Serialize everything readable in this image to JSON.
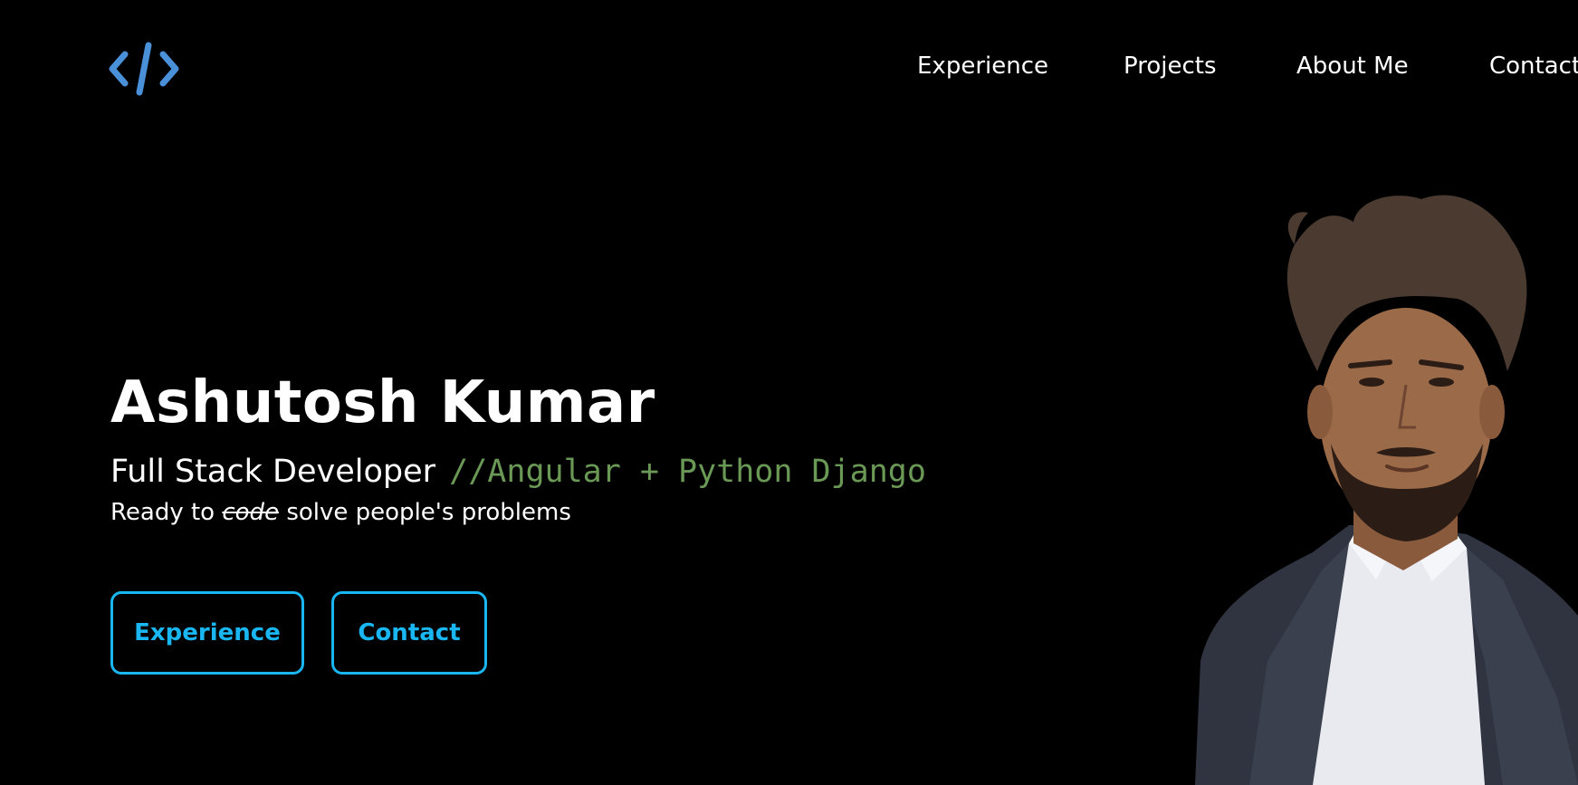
{
  "logo": {
    "icon": "code-brackets-icon",
    "color": "#4a90d9"
  },
  "nav": {
    "items": [
      {
        "label": "Experience"
      },
      {
        "label": "Projects"
      },
      {
        "label": "About Me"
      },
      {
        "label": "Contact"
      }
    ]
  },
  "hero": {
    "name": "Ashutosh Kumar",
    "role": "Full Stack Developer",
    "stack": "//Angular + Python Django",
    "tagline_prefix": "Ready to ",
    "tagline_struck": "code",
    "tagline_suffix": " solve people's problems"
  },
  "buttons": {
    "experience_label": "Experience",
    "contact_label": "Contact"
  },
  "colors": {
    "background": "#000000",
    "accent": "#19b6f2",
    "code_comment": "#6a9955",
    "logo": "#4a90d9"
  }
}
